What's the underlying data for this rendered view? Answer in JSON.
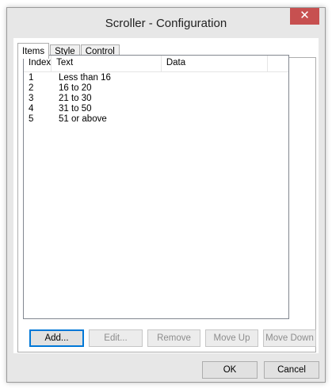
{
  "window": {
    "title": "Scroller - Configuration",
    "close_glyph": "✕"
  },
  "tabs": [
    {
      "label": "Items",
      "active": true
    },
    {
      "label": "Style",
      "active": false
    },
    {
      "label": "Control",
      "active": false
    }
  ],
  "listview": {
    "columns": [
      "Index",
      "Text",
      "Data",
      ""
    ],
    "rows": [
      {
        "index": "1",
        "text": "Less than 16"
      },
      {
        "index": "2",
        "text": "16 to 20"
      },
      {
        "index": "3",
        "text": "21 to 30"
      },
      {
        "index": "4",
        "text": "31 to 50"
      },
      {
        "index": "5",
        "text": "51 or above"
      }
    ]
  },
  "item_buttons": {
    "add": "Add...",
    "edit": "Edit...",
    "remove": "Remove",
    "move_up": "Move Up",
    "move_down": "Move Down"
  },
  "dialog_buttons": {
    "ok": "OK",
    "cancel": "Cancel"
  },
  "colors": {
    "close_button": "#c75050",
    "focus_border": "#0078d7"
  }
}
